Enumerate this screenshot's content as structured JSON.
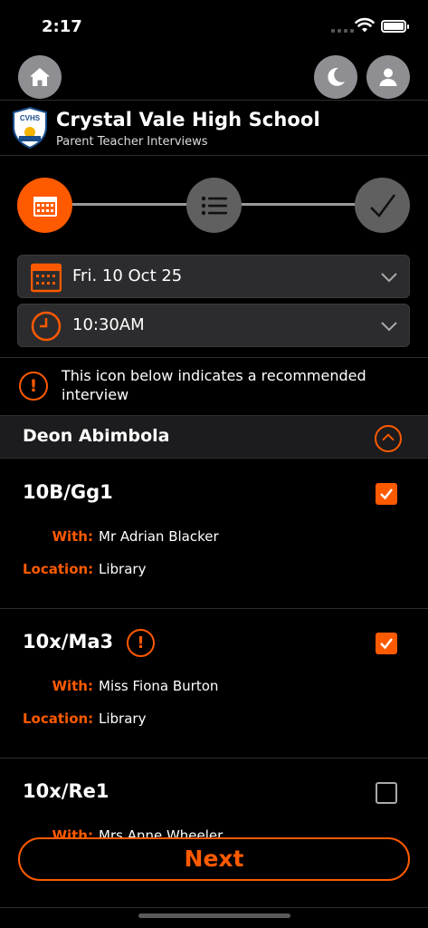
{
  "status_bar": {
    "time": "2:17"
  },
  "header": {
    "school_name": "Crystal Vale High School",
    "subtitle": "Parent Teacher Interviews",
    "crest_text": "CVHS"
  },
  "icons": {
    "home": "home-icon",
    "moon": "moon-icon",
    "user": "user-icon",
    "calendar": "calendar-icon",
    "list": "list-icon",
    "check": "check-icon",
    "clock": "clock-icon",
    "chevron": "chevron-down-icon",
    "alert": "alert-icon"
  },
  "colors": {
    "accent": "#ff5a00",
    "background": "#000000",
    "panel": "#2c2c2e",
    "inactive_step": "#606060"
  },
  "stepper": {
    "steps": [
      "date",
      "list",
      "confirm"
    ],
    "active_step": "date"
  },
  "date_picker": {
    "value": "Fri. 10 Oct 25"
  },
  "time_picker": {
    "value": "10:30AM"
  },
  "info": {
    "text": "This icon below indicates a recommended interview",
    "icon_text": "!"
  },
  "student": {
    "name": "Deon Abimbola",
    "expanded": true
  },
  "labels": {
    "with": "With:",
    "location": "Location:"
  },
  "classes": [
    {
      "code": "10B/Gg1",
      "teacher": "Mr Adrian Blacker",
      "location": "Library",
      "recommended": false,
      "selected": true
    },
    {
      "code": "10x/Ma3",
      "teacher": "Miss Fiona Burton",
      "location": "Library",
      "recommended": true,
      "selected": true
    },
    {
      "code": "10x/Re1",
      "teacher": "Mrs Anne Wheeler",
      "location": "",
      "recommended": false,
      "selected": false
    }
  ],
  "next_button": {
    "label": "Next"
  }
}
